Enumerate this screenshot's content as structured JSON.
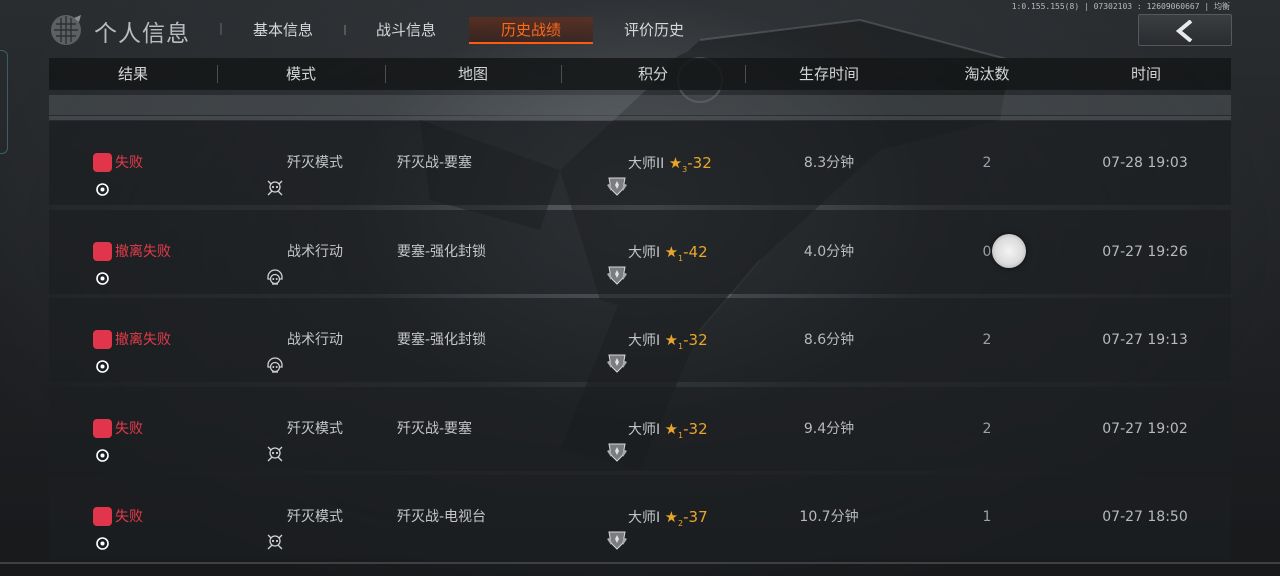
{
  "header": {
    "title": "个人信息",
    "status_text": "1:0.155.155(8) | 07302103 : 12609060667 | 均衡",
    "tabs": [
      {
        "label": "基本信息",
        "active": false
      },
      {
        "label": "战斗信息",
        "active": false
      },
      {
        "label": "历史战绩",
        "active": true
      },
      {
        "label": "评价历史",
        "active": false
      }
    ],
    "accent_color": "#ff6a1a"
  },
  "table": {
    "columns": [
      "结果",
      "模式",
      "地图",
      "积分",
      "生存时间",
      "淘汰数",
      "时间"
    ],
    "rows": [
      {
        "result": "失败",
        "mode": "歼灭模式",
        "mode_icon": "skull-crosshair-icon",
        "map": "歼灭战-要塞",
        "rank": "大师II",
        "stars": "3",
        "delta": "-32",
        "survival": "8.3分钟",
        "eliminations": "2",
        "time": "07-28 19:03"
      },
      {
        "result": "撤离失败",
        "mode": "战术行动",
        "mode_icon": "skull-helmet-icon",
        "map": "要塞-强化封锁",
        "rank": "大师I",
        "stars": "1",
        "delta": "-42",
        "survival": "4.0分钟",
        "eliminations": "0",
        "time": "07-27 19:26"
      },
      {
        "result": "撤离失败",
        "mode": "战术行动",
        "mode_icon": "skull-helmet-icon",
        "map": "要塞-强化封锁",
        "rank": "大师I",
        "stars": "1",
        "delta": "-32",
        "survival": "8.6分钟",
        "eliminations": "2",
        "time": "07-27 19:13"
      },
      {
        "result": "失败",
        "mode": "歼灭模式",
        "mode_icon": "skull-crosshair-icon",
        "map": "歼灭战-要塞",
        "rank": "大师I",
        "stars": "1",
        "delta": "-32",
        "survival": "9.4分钟",
        "eliminations": "2",
        "time": "07-27 19:02"
      },
      {
        "result": "失败",
        "mode": "歼灭模式",
        "mode_icon": "skull-crosshair-icon",
        "map": "歼灭战-电视台",
        "rank": "大师I",
        "stars": "2",
        "delta": "-37",
        "survival": "10.7分钟",
        "eliminations": "1",
        "time": "07-27 18:50"
      }
    ],
    "result_color": "#e23b4a",
    "score_color": "#e9a62a"
  }
}
